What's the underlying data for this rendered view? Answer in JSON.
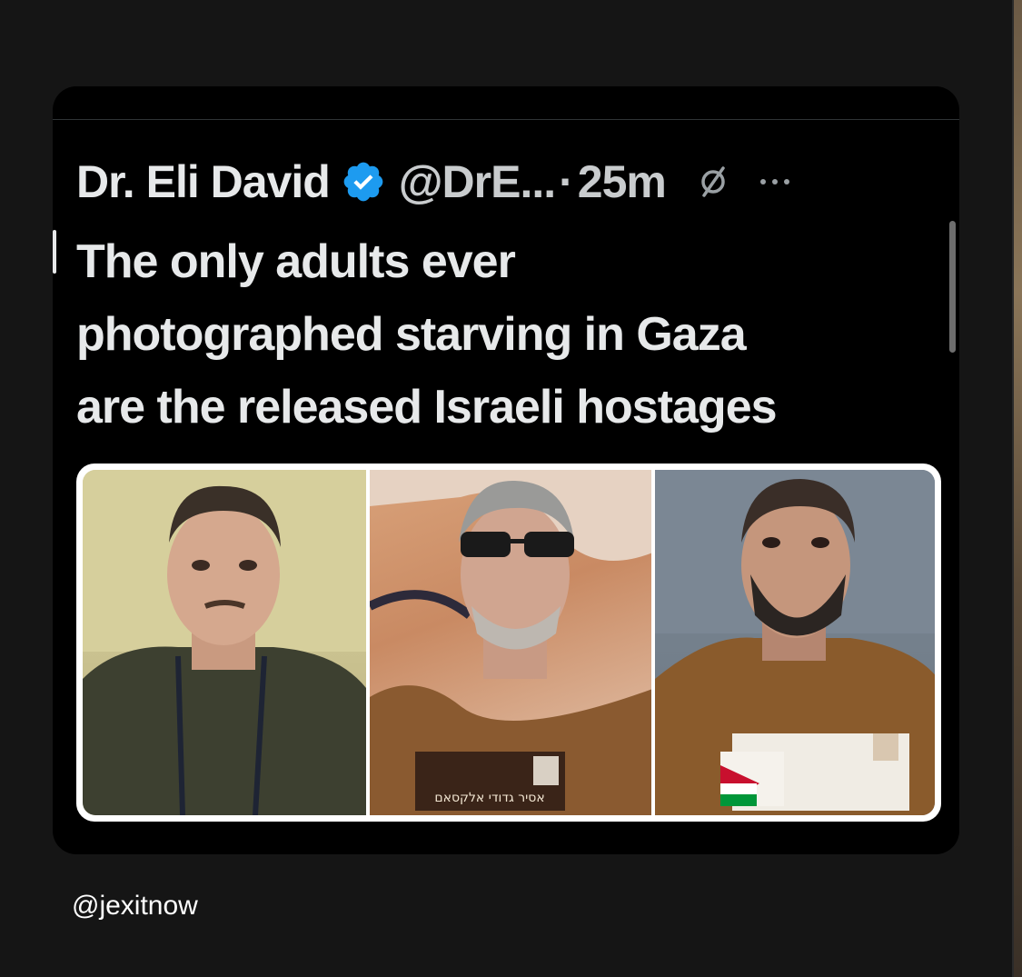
{
  "tweet": {
    "author_name": "Dr. Eli David",
    "handle": "@DrE...",
    "separator": "·",
    "time": "25m",
    "text_lines": [
      "The only adults ever",
      "photographed starving in Gaza",
      "are the released Israeli hostages"
    ],
    "media": {
      "badge_text_panel2": "אסיר גדודי אלקסאם"
    }
  },
  "icons": {
    "verified": "verified-badge-icon",
    "grok": "grok-icon",
    "more": "more-options-icon"
  },
  "colors": {
    "verified_blue": "#1d9bf0",
    "text_primary": "#e7e9ea",
    "text_secondary": "#c9ccce",
    "card_background": "#000000",
    "page_background": "#151515"
  },
  "watermark": "@jexitnow"
}
